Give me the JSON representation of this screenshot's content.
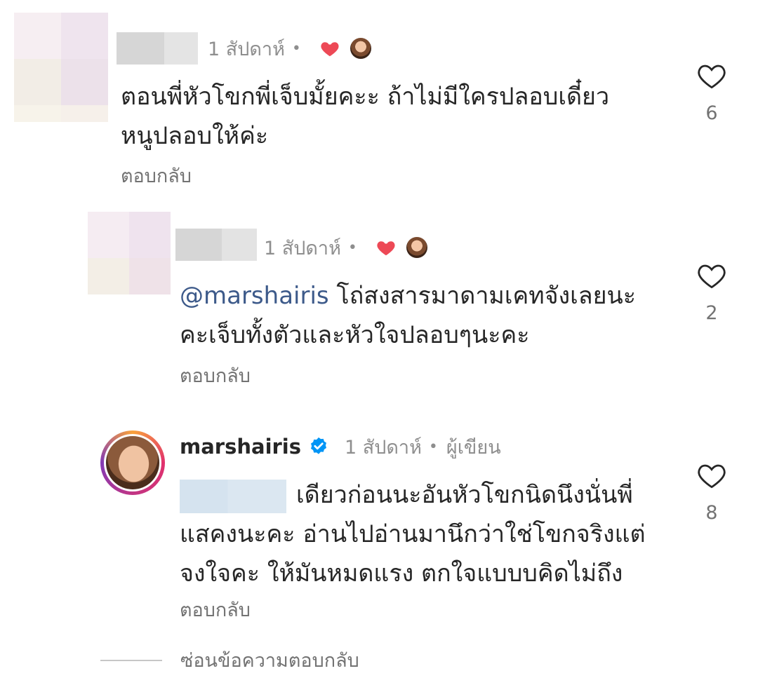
{
  "comments": [
    {
      "time": "1 สัปดาห์",
      "dot": "•",
      "lines": [
        "ตอนพี่หัวโขกพี่เจ็บมั้ยคะะ ถ้าไม่มีใครปลอบเดี๋ยว",
        "หนูปลอบให้ค่ะ"
      ],
      "reply_label": "ตอบกลับ",
      "likes": "6"
    },
    {
      "time": "1 สัปดาห์",
      "dot": "•",
      "mention": "@marshairis",
      "line1_rest": " โถ่สงสารมาดามเคทจังเลยนะ",
      "line2": "คะเจ็บทั้งตัวและหัวใจปลอบๆนะคะ",
      "reply_label": "ตอบกลับ",
      "likes": "2"
    },
    {
      "username": "marshairis",
      "time": "1 สัปดาห์",
      "dot": "•",
      "author_label": "ผู้เขียน",
      "line1_rest": "เดียวก่อนนะอันหัวโขกนิดนึงนั่นพี่",
      "line2": "แสคงนะคะ อ่านไปอ่านมานึกว่าใช่โขกจริงแต่",
      "line3": "จงใจคะ ให้มันหมดแรง ตกใจแบบบคิดไม่ถึง",
      "reply_label": "ตอบกลับ",
      "likes": "8"
    }
  ],
  "hide_replies": "ซ่อนข้อความตอบกลับ",
  "icons": {
    "heart": "heart-outline-icon",
    "liked_by_author": "red-heart-icon",
    "verified": "verified-badge-icon"
  },
  "colors": {
    "text": "#262626",
    "muted": "#737373",
    "mention": "#3d5a8a",
    "heart_red": "#ed4956",
    "verified_blue": "#0095f6"
  }
}
